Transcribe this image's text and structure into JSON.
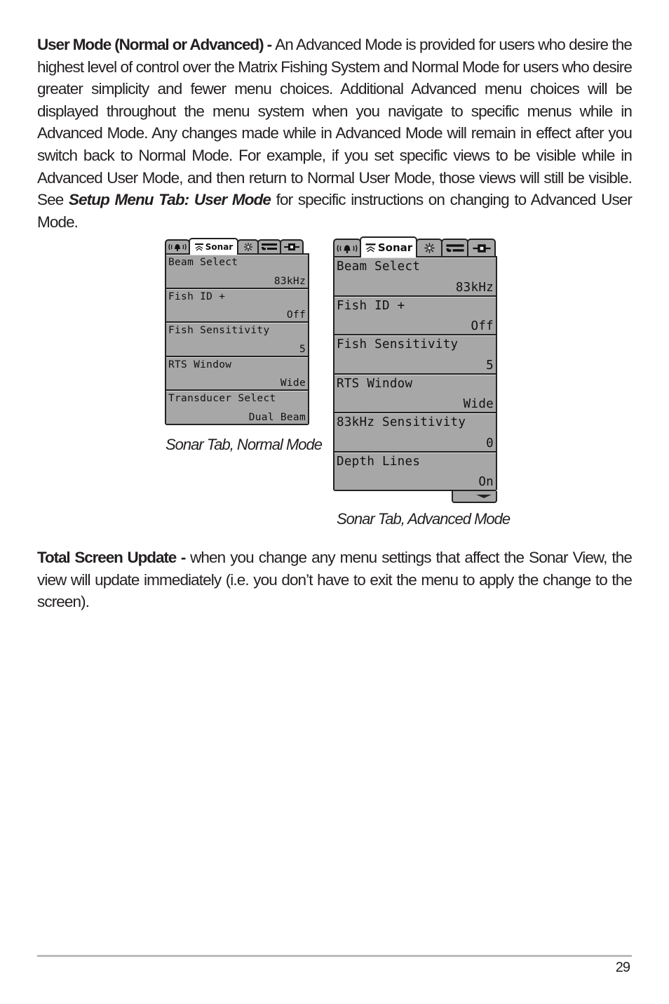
{
  "paragraphs": [
    {
      "lead": "User Mode (Normal or Advanced) - ",
      "text_before_ref": "An Advanced Mode is provided for users who desire the highest level of control over the Matrix Fishing System and Normal Mode for users who desire greater simplicity and fewer menu choices. Additional Advanced menu choices will be displayed throughout the menu system when you navigate to specific menus while in Advanced Mode. Any changes made while in Advanced Mode will remain in effect after you switch back to Normal Mode. For example, if you set specific views to be visible while in Advanced User Mode, and then return to Normal User Mode, those views will still be visible. See ",
      "ref": "Setup Menu Tab: User Mode",
      "text_after_ref": " for specific instructions on changing to Advanced User Mode."
    },
    {
      "lead": "Total Screen Update - ",
      "text": "when you change any menu settings that affect the Sonar View, the view will update immediately (i.e. you don’t have to exit the menu to apply the change to the screen)."
    }
  ],
  "tabs": [
    {
      "icon": "alarm-bell-icon",
      "label": ""
    },
    {
      "icon": "sonar-icon",
      "label": "Sonar",
      "active": true
    },
    {
      "icon": "navigation-light-icon",
      "label": ""
    },
    {
      "icon": "setup-wrench-icon",
      "label": ""
    },
    {
      "icon": "accessory-plug-icon",
      "label": ""
    }
  ],
  "screens": {
    "normal": {
      "caption": "Sonar Tab, Normal Mode",
      "items": [
        {
          "name": "Beam Select",
          "value": "83kHz"
        },
        {
          "name": "Fish ID +",
          "value": "Off"
        },
        {
          "name": "Fish Sensitivity",
          "value": "5"
        },
        {
          "name": "RTS Window",
          "value": "Wide"
        },
        {
          "name": "Transducer Select",
          "value": "Dual Beam"
        }
      ]
    },
    "advanced": {
      "caption": "Sonar Tab, Advanced Mode",
      "items": [
        {
          "name": "Beam Select",
          "value": "83kHz"
        },
        {
          "name": "Fish ID +",
          "value": "Off"
        },
        {
          "name": "Fish Sensitivity",
          "value": "5"
        },
        {
          "name": "RTS Window",
          "value": "Wide"
        },
        {
          "name": "83kHz Sensitivity",
          "value": "0"
        },
        {
          "name": "Depth Lines",
          "value": "On"
        }
      ],
      "has_more_indicator": true
    }
  },
  "footer": {
    "page_number": "29"
  }
}
